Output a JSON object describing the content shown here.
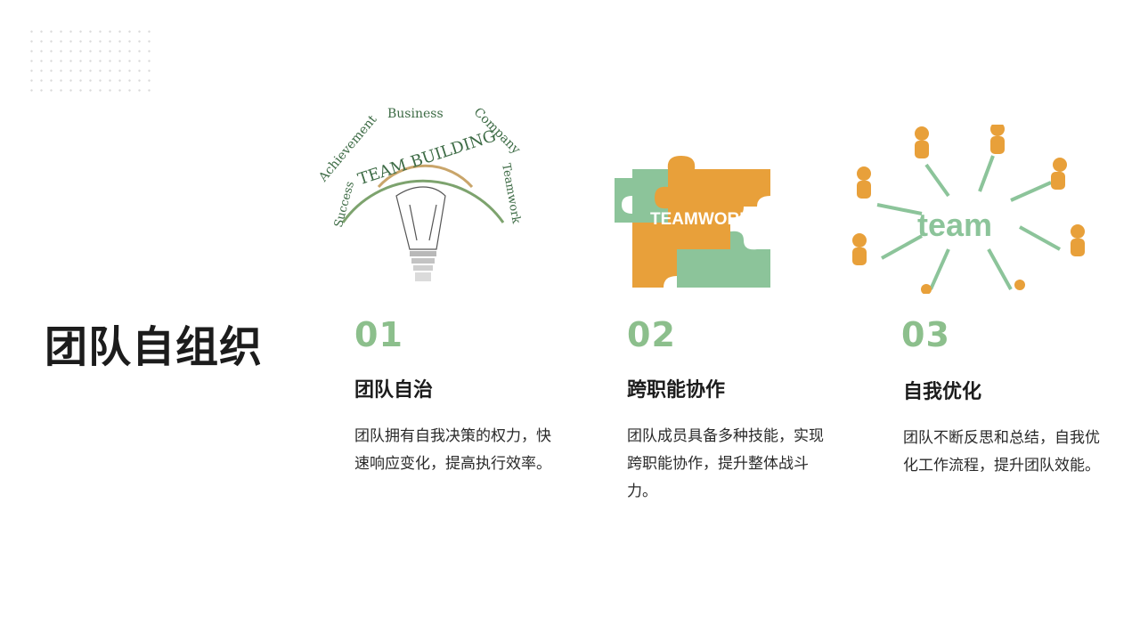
{
  "slide": {
    "title": "团队自组织"
  },
  "items": [
    {
      "number": "01",
      "heading": "团队自治",
      "description": "团队拥有自我决策的权力，快速响应变化，提高执行效率。",
      "illustration": {
        "icon": "team-building-lightbulb-icon",
        "arc_words": [
          "Achievement",
          "Business",
          "Company",
          "Success",
          "Teamwork"
        ],
        "center_text": "TEAM BUILDING"
      }
    },
    {
      "number": "02",
      "heading": "跨职能协作",
      "description": "团队成员具备多种技能，实现跨职能协作，提升整体战斗力。",
      "illustration": {
        "icon": "teamwork-puzzle-icon",
        "label": "TEAMWORK"
      }
    },
    {
      "number": "03",
      "heading": "自我优化",
      "description": "团队不断反思和总结，自我优化工作流程，提升团队效能。",
      "illustration": {
        "icon": "team-network-people-icon",
        "label": "team"
      }
    }
  ],
  "colors": {
    "accent_green": "#8cbf8c",
    "accent_orange": "#e8a03a",
    "title": "#1c1c1c"
  }
}
